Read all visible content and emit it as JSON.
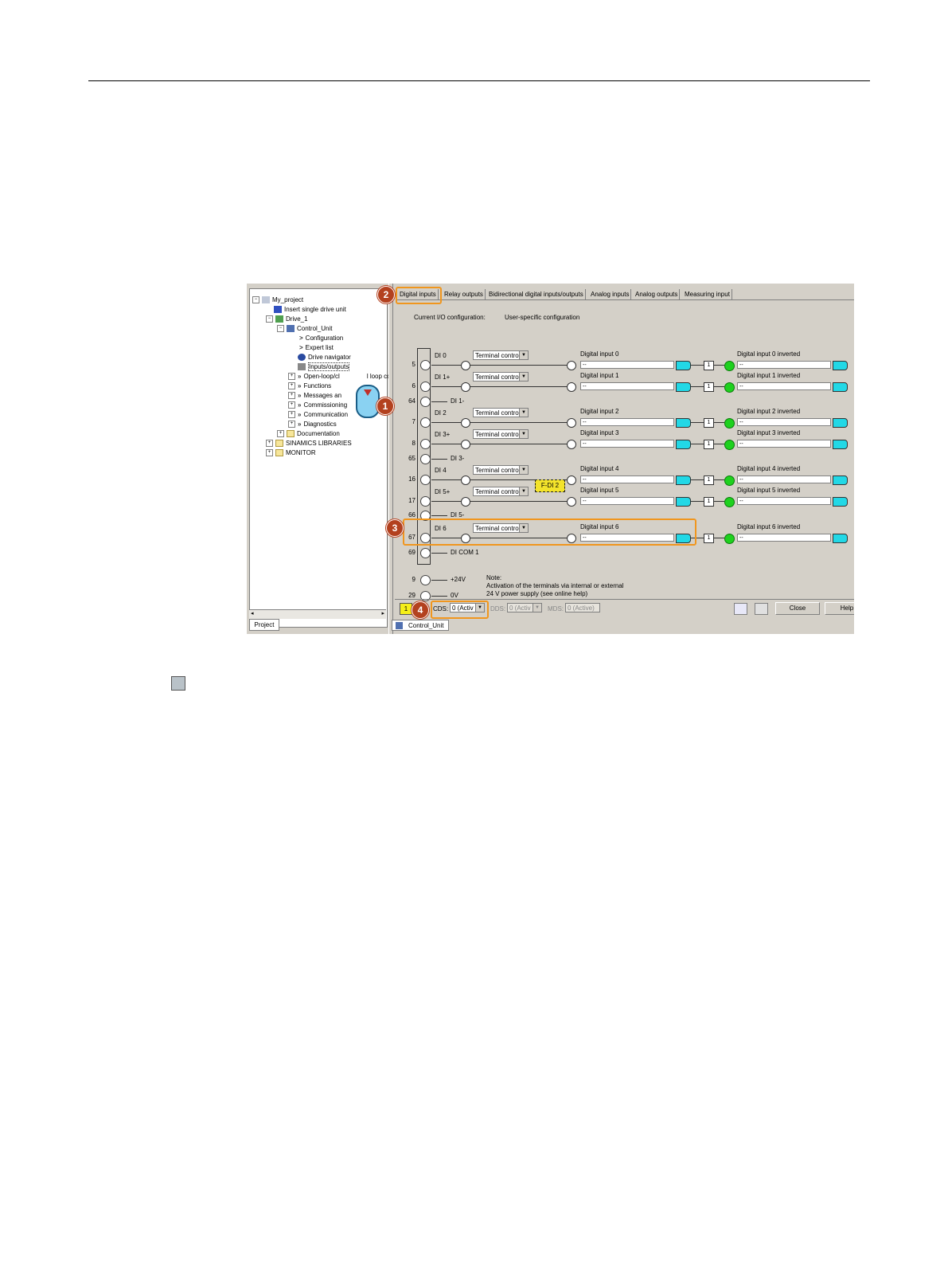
{
  "tree": {
    "project": "My_project",
    "insert": "Insert single drive unit",
    "drive": "Drive_1",
    "control_unit": "Control_Unit",
    "configuration": "Configuration",
    "expert_list": "Expert list",
    "drive_navigator": "Drive navigator",
    "inputs_outputs": "Inputs/outputs",
    "open_loop": "Open-loop/cl",
    "open_loop_rest": "l loop cor",
    "functions": "Functions",
    "messages": "Messages an",
    "commissioning": "Commissioning",
    "communication": "Communication",
    "diagnostics": "Diagnostics",
    "documentation": "Documentation",
    "libraries": "SINAMICS LIBRARIES",
    "monitor": "MONITOR",
    "project_tab": "Project"
  },
  "tabs": [
    "Digital inputs",
    "Relay outputs",
    "Bidirectional digital inputs/outputs",
    "Analog inputs",
    "Analog outputs",
    "Measuring input"
  ],
  "hints": {
    "current": "Current I/O configuration:",
    "user": "User-specific configuration"
  },
  "inputs": [
    {
      "terminal": "5",
      "name": "DI 0",
      "mode": "Terminal control",
      "label": "Digital input 0",
      "value": "--",
      "inv_label": "Digital input 0 inverted",
      "inv_value": "--"
    },
    {
      "terminal": "6",
      "name": "DI 1+",
      "mode": "Terminal control",
      "label": "Digital input 1",
      "value": "--",
      "inv_label": "Digital input 1 inverted",
      "inv_value": "--"
    },
    {
      "terminal": "7",
      "name": "DI 2",
      "mode": "Terminal control",
      "label": "Digital input 2",
      "value": "--",
      "inv_label": "Digital input 2 inverted",
      "inv_value": "--"
    },
    {
      "terminal": "8",
      "name": "DI 3+",
      "mode": "Terminal control",
      "label": "Digital input 3",
      "value": "--",
      "inv_label": "Digital input 3 inverted",
      "inv_value": "--"
    },
    {
      "terminal": "16",
      "name": "DI 4",
      "mode": "Terminal control",
      "label": "Digital input 4",
      "value": "--",
      "inv_label": "Digital input 4 inverted",
      "inv_value": "--"
    },
    {
      "terminal": "17",
      "name": "DI 5+",
      "mode": "Terminal control",
      "label": "Digital input 5",
      "value": "--",
      "inv_label": "Digital input 5 inverted",
      "inv_value": "--"
    },
    {
      "terminal": "67",
      "name": "DI 6",
      "mode": "Terminal control",
      "label": "Digital input 6",
      "value": "--",
      "inv_label": "Digital input 6 inverted",
      "inv_value": "--"
    }
  ],
  "commons": [
    {
      "terminal": "64",
      "name": "DI 1-"
    },
    {
      "terminal": "65",
      "name": "DI 3-"
    },
    {
      "terminal": "66",
      "name": "DI 5-"
    },
    {
      "terminal": "69",
      "name": "DI COM 1"
    }
  ],
  "supply": [
    {
      "terminal": "9",
      "name": "+24V"
    },
    {
      "terminal": "29",
      "name": "0V"
    }
  ],
  "fdi_label": "F-DI 2",
  "inv_symbol": "1",
  "note": {
    "title": "Note:",
    "line1": "Activation of the terminals via internal or external",
    "line2": "24 V power supply (see online help)"
  },
  "status": {
    "indicator": "1",
    "cds_label": "CDS:",
    "cds_value": "0 (Activ",
    "dds_label": "DDS:",
    "dds_value": "0 (Activ",
    "mds_label": "MDS:",
    "mds_value": "0 (Active)",
    "close": "Close",
    "help": "Help"
  },
  "bottom_tab": "Control_Unit",
  "badges": [
    "1",
    "2",
    "3",
    "4"
  ],
  "colors": {
    "highlight": "#f0961e",
    "badge": "#b3411f",
    "led": "#1ed11e",
    "connector": "#22d8e6"
  }
}
